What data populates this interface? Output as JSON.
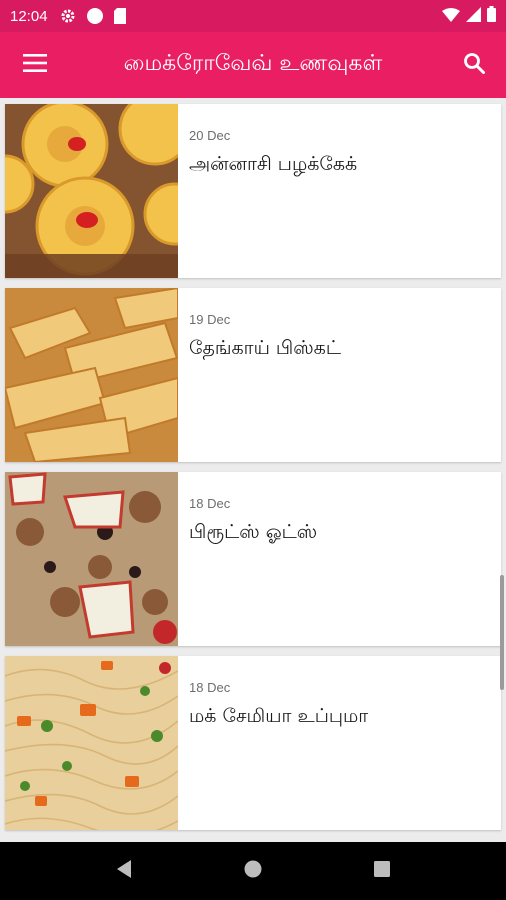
{
  "status_bar": {
    "time": "12:04",
    "icons": [
      "settings-icon",
      "circle-icon",
      "sd-card-icon"
    ],
    "right_icons": [
      "wifi-icon",
      "signal-icon",
      "battery-icon"
    ]
  },
  "app_bar": {
    "title": "மைக்ரோவேவ் உணவுகள்",
    "menu_icon": "hamburger-menu-icon",
    "search_icon": "search-icon",
    "color": "#e91e63",
    "status_color": "#d81b60"
  },
  "recipes": [
    {
      "date": "20 Dec",
      "title": "அன்னாசி பழக்கேக்",
      "image": "pineapple-cake-image"
    },
    {
      "date": "19 Dec",
      "title": "தேங்காய் பிஸ்கட்",
      "image": "coconut-biscuit-image"
    },
    {
      "date": "18 Dec",
      "title": "பிரூட்ஸ் ஓட்ஸ்",
      "image": "fruits-oats-image"
    },
    {
      "date": "18 Dec",
      "title": "மக் சேமியா உப்புமா",
      "image": "semiya-upma-image"
    }
  ],
  "nav_bar": {
    "buttons": [
      "back-icon",
      "home-icon",
      "recents-icon"
    ]
  }
}
